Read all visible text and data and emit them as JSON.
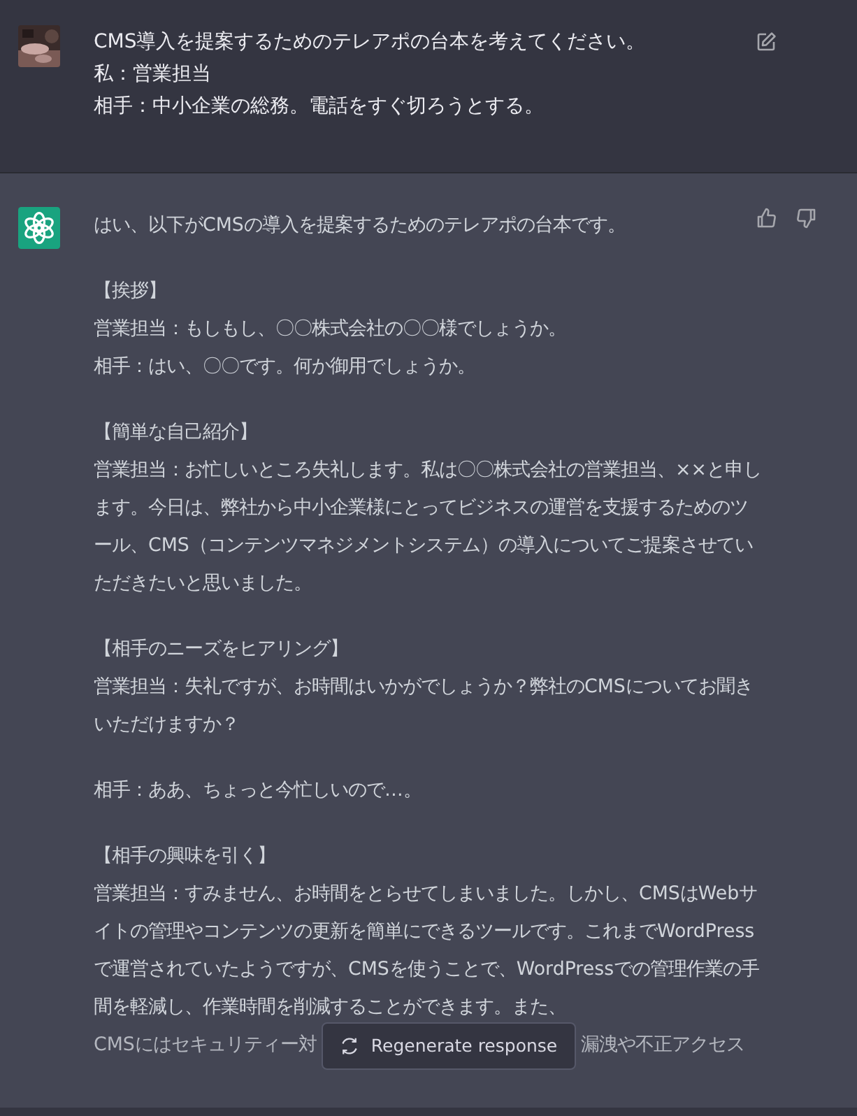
{
  "user_message": {
    "lines": [
      "CMS導入を提案するためのテレアポの台本を考えてください。",
      "私：営業担当",
      "相手：中小企業の総務。電話をすぐ切ろうとする。"
    ]
  },
  "assistant_message": {
    "blocks": [
      {
        "lines": [
          "はい、以下がCMSの導入を提案するためのテレアポの台本です。"
        ]
      },
      {
        "lines": [
          "【挨拶】",
          "営業担当：もしもし、〇〇株式会社の〇〇様でしょうか。",
          "相手：はい、〇〇です。何か御用でしょうか。"
        ]
      },
      {
        "lines": [
          "【簡単な自己紹介】",
          "営業担当：お忙しいところ失礼します。私は〇〇株式会社の営業担当、××と申します。今日は、弊社から中小企業様にとってビジネスの運営を支援するためのツール、CMS（コンテンツマネジメントシステム）の導入についてご提案させていただきたいと思いました。"
        ]
      },
      {
        "lines": [
          "【相手のニーズをヒアリング】",
          "営業担当：失礼ですが、お時間はいかがでしょうか？弊社のCMSについてお聞きいただけますか？"
        ]
      },
      {
        "lines": [
          "相手：ああ、ちょっと今忙しいので…。"
        ]
      },
      {
        "lines": [
          "【相手の興味を引く】",
          "営業担当：すみません、お時間をとらせてしまいました。しかし、CMSはWebサイトの管理やコンテンツの更新を簡単にできるツールです。これまでWordPressで運営されていたようですが、CMSを使うことで、WordPressでの管理作業の手間を軽減し、作業時間を削減することができます。また、"
        ]
      }
    ],
    "partial_line": {
      "before": "CMSにはセキュリティー対",
      "after": "漏洩や不正アクセス"
    }
  },
  "regenerate_button": {
    "label": "Regenerate response"
  }
}
